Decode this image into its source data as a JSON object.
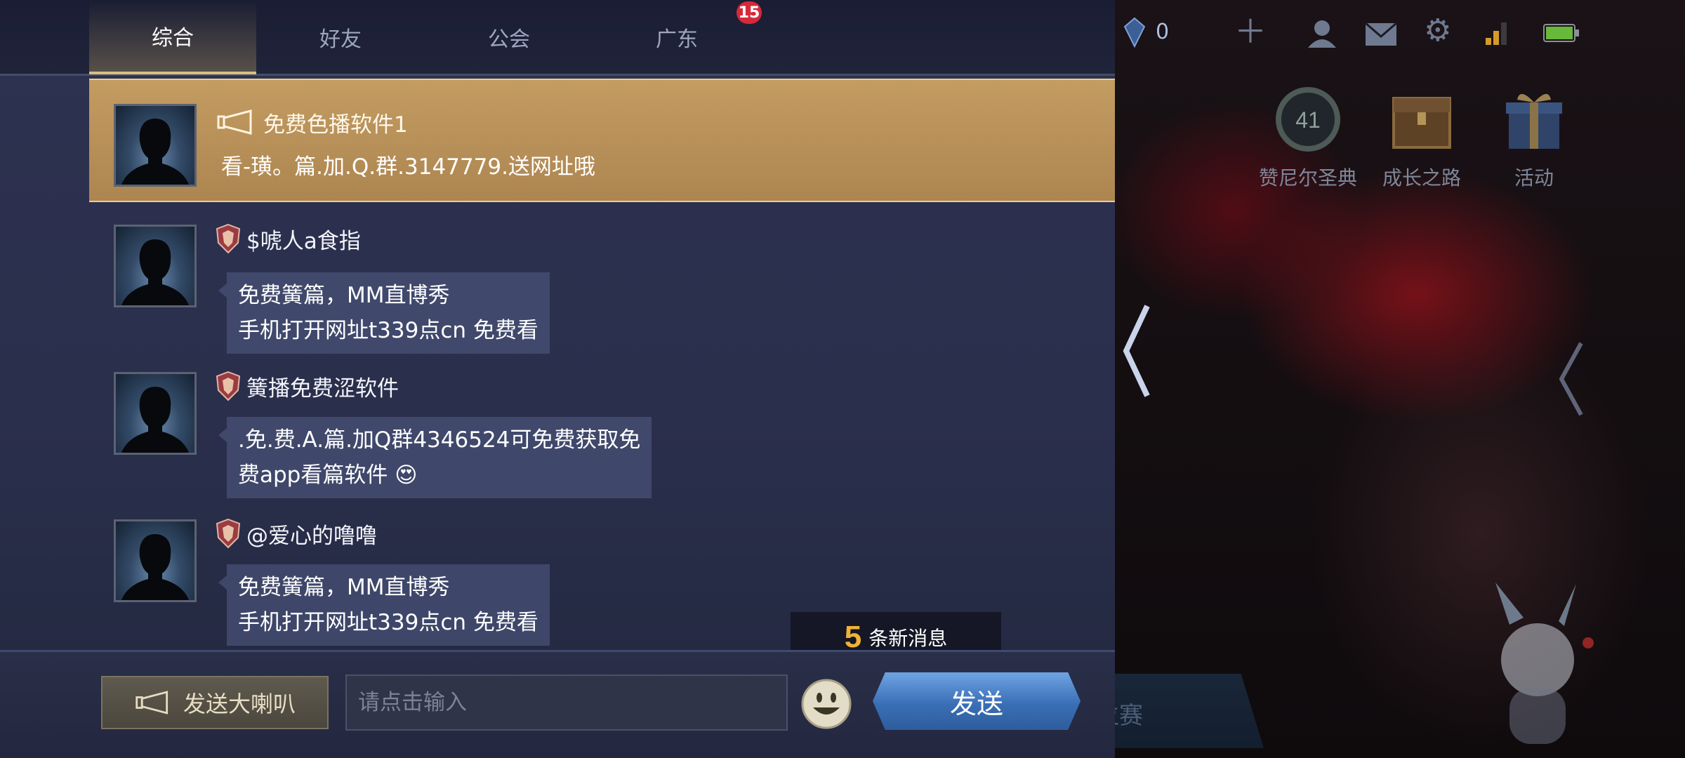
{
  "tabs": [
    {
      "label": "综合",
      "active": true
    },
    {
      "label": "好友"
    },
    {
      "label": "公会"
    },
    {
      "label": "广东"
    }
  ],
  "tab_badge": "15",
  "messages": [
    {
      "type": "broadcast",
      "sender": "免费色播软件1",
      "text": "看-璜。篇.加.Q.群.3147779.送网址哦"
    },
    {
      "type": "chat",
      "sender": "$唬人a食指",
      "lines": [
        "免费簧篇，MM直博秀",
        "手机打开网址t339点cn 免费看"
      ]
    },
    {
      "type": "chat",
      "sender": "簧播免费涩软件",
      "lines": [
        ".免.费.A.篇.加Q群4346524可免费获取免",
        "费app看篇软件 😍"
      ]
    },
    {
      "type": "chat",
      "sender": "@爱心的噜噜",
      "lines": [
        "免费簧篇，MM直博秀",
        "手机打开网址t339点cn 免费看"
      ]
    }
  ],
  "new_messages": {
    "count": "5",
    "label": "条新消息"
  },
  "input": {
    "placeholder": "请点击输入",
    "horn_button": "发送大喇叭",
    "send_button": "发送"
  },
  "game": {
    "gem_count": "0",
    "tiles": [
      {
        "label": "赞尼尔圣典",
        "badge": "41"
      },
      {
        "label": "成长之路"
      },
      {
        "label": "活动"
      }
    ],
    "ranked_label": "位赛"
  },
  "colors": {
    "accent_gold": "#c39c62",
    "send_blue": "#3a6fb6",
    "badge_red": "#d6293a",
    "count_orange": "#f2b233"
  }
}
